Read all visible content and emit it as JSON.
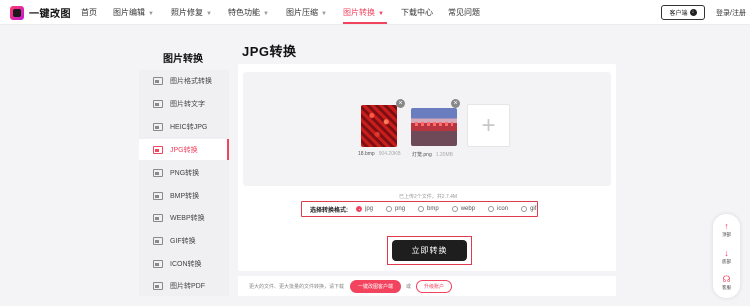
{
  "app": {
    "name": "一键改图"
  },
  "nav": {
    "items": [
      {
        "label": "首页",
        "has_caret": false,
        "active": false
      },
      {
        "label": "图片编辑",
        "has_caret": true,
        "active": false
      },
      {
        "label": "照片修复",
        "has_caret": true,
        "active": false
      },
      {
        "label": "特色功能",
        "has_caret": true,
        "active": false
      },
      {
        "label": "图片压缩",
        "has_caret": true,
        "active": false
      },
      {
        "label": "图片转换",
        "has_caret": true,
        "active": true
      },
      {
        "label": "下载中心",
        "has_caret": false,
        "active": false
      },
      {
        "label": "常见问题",
        "has_caret": false,
        "active": false
      }
    ],
    "client_button": "客户端",
    "login": "登录/注册"
  },
  "sidebar": {
    "title": "图片转换",
    "items": [
      {
        "label": "图片格式转换",
        "active": false
      },
      {
        "label": "图片转文字",
        "active": false
      },
      {
        "label": "HEIC转JPG",
        "active": false
      },
      {
        "label": "JPG转换",
        "active": true
      },
      {
        "label": "PNG转换",
        "active": false
      },
      {
        "label": "BMP转换",
        "active": false
      },
      {
        "label": "WEBP转换",
        "active": false
      },
      {
        "label": "GIF转换",
        "active": false
      },
      {
        "label": "ICON转换",
        "active": false
      },
      {
        "label": "图片转PDF",
        "active": false
      }
    ]
  },
  "main": {
    "title": "JPG转换",
    "files": [
      {
        "name": "18.bmp",
        "size": "904.20KB"
      },
      {
        "name": "灯笼.png",
        "size": "1.20MB"
      }
    ],
    "add_icon": "plus-icon",
    "upload_info": "已上传2个文件，共2.7.4M",
    "format": {
      "label": "选择转换格式:",
      "options": [
        {
          "label": "jpg",
          "selected": true
        },
        {
          "label": "png",
          "selected": false
        },
        {
          "label": "bmp",
          "selected": false
        },
        {
          "label": "webp",
          "selected": false
        },
        {
          "label": "icon",
          "selected": false
        },
        {
          "label": "gif",
          "selected": false
        }
      ]
    },
    "convert_button": "立即转换",
    "bottom": {
      "tip": "更大的文件、更大批量的文件转换，请下载",
      "client_button": "一键改图客户端",
      "or": "或",
      "upgrade_button": "升级账户"
    }
  },
  "float_tools": [
    {
      "icon": "arrow-up-icon",
      "label": "顶部"
    },
    {
      "icon": "arrow-down-icon",
      "label": "底部"
    },
    {
      "icon": "headset-icon",
      "label": "客服"
    }
  ],
  "colors": {
    "accent": "#f2435f",
    "dark_button": "#1e1e1e",
    "highlight_border": "#e23b4d"
  }
}
